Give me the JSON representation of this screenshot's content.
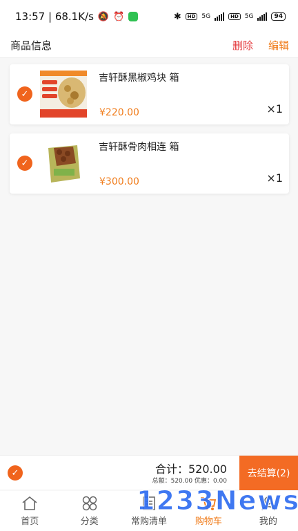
{
  "status_bar": {
    "time_speed": "13:57 | 68.1K/s",
    "net_label_1": "5G",
    "net_label_2": "5G",
    "hd_1": "HD",
    "hd_2": "HD",
    "battery": "94"
  },
  "header": {
    "title": "商品信息",
    "delete_label": "删除",
    "edit_label": "编辑"
  },
  "items": [
    {
      "name": "吉轩酥黑椒鸡块 箱",
      "price": "¥220.00",
      "qty": "×1",
      "checked": true
    },
    {
      "name": "吉轩酥骨肉相连 箱",
      "price": "¥300.00",
      "qty": "×1",
      "checked": true
    }
  ],
  "summary": {
    "total_label": "合计：520.00",
    "sub_label": "总额：520.00  优惠：0.00",
    "checkout_label": "去结算(2)"
  },
  "tabs": [
    {
      "label": "首页",
      "icon": "home-icon",
      "active": false
    },
    {
      "label": "分类",
      "icon": "category-icon",
      "active": false
    },
    {
      "label": "常购清单",
      "icon": "list-icon",
      "active": false
    },
    {
      "label": "购物车",
      "icon": "cart-icon",
      "active": true
    },
    {
      "label": "我的",
      "icon": "profile-icon",
      "active": false
    }
  ],
  "watermark": "1233News",
  "colors": {
    "accent": "#f07c1b",
    "checkout": "#f36b24",
    "delete": "#e4393c",
    "check": "#f0641d"
  }
}
